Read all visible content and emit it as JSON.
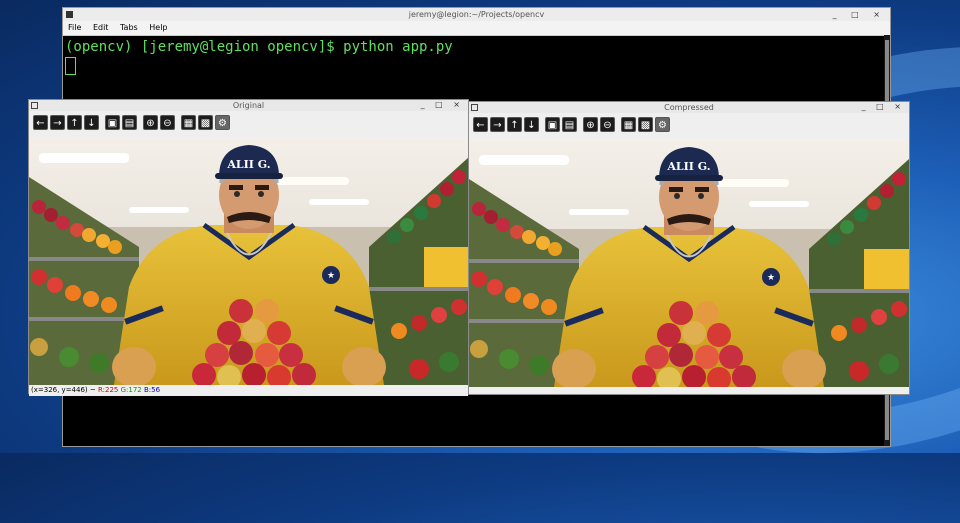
{
  "terminal": {
    "title": "jeremy@legion:~/Projects/opencv",
    "window_controls": "_ □ ×",
    "menu": [
      "File",
      "Edit",
      "Tabs",
      "Help"
    ],
    "prompt_line": "(opencv) [jeremy@legion opencv]$ python app.py"
  },
  "windows": [
    {
      "title": "Original",
      "controls": "_ □ ×",
      "status": {
        "coords": "(x=326, y=446) ~",
        "r": "R:225",
        "g": "G:172",
        "b": "B:56"
      }
    },
    {
      "title": "Compressed",
      "controls": "_ □ ×"
    }
  ],
  "toolbar_icons": [
    {
      "name": "pan-left-icon",
      "glyph": "←"
    },
    {
      "name": "pan-right-icon",
      "glyph": "→"
    },
    {
      "name": "pan-up-icon",
      "glyph": "↑"
    },
    {
      "name": "pan-down-icon",
      "glyph": "↓"
    },
    {
      "name": "zoom-fit-icon",
      "glyph": "▣"
    },
    {
      "name": "zoom-original-icon",
      "glyph": "▤"
    },
    {
      "name": "zoom-in-icon",
      "glyph": "⊕"
    },
    {
      "name": "zoom-out-icon",
      "glyph": "⊖"
    },
    {
      "name": "save-icon",
      "glyph": "▦"
    },
    {
      "name": "copy-icon",
      "glyph": "▩"
    },
    {
      "name": "properties-icon",
      "glyph": "⚙"
    }
  ],
  "image": {
    "cap_text": "ALII G."
  }
}
